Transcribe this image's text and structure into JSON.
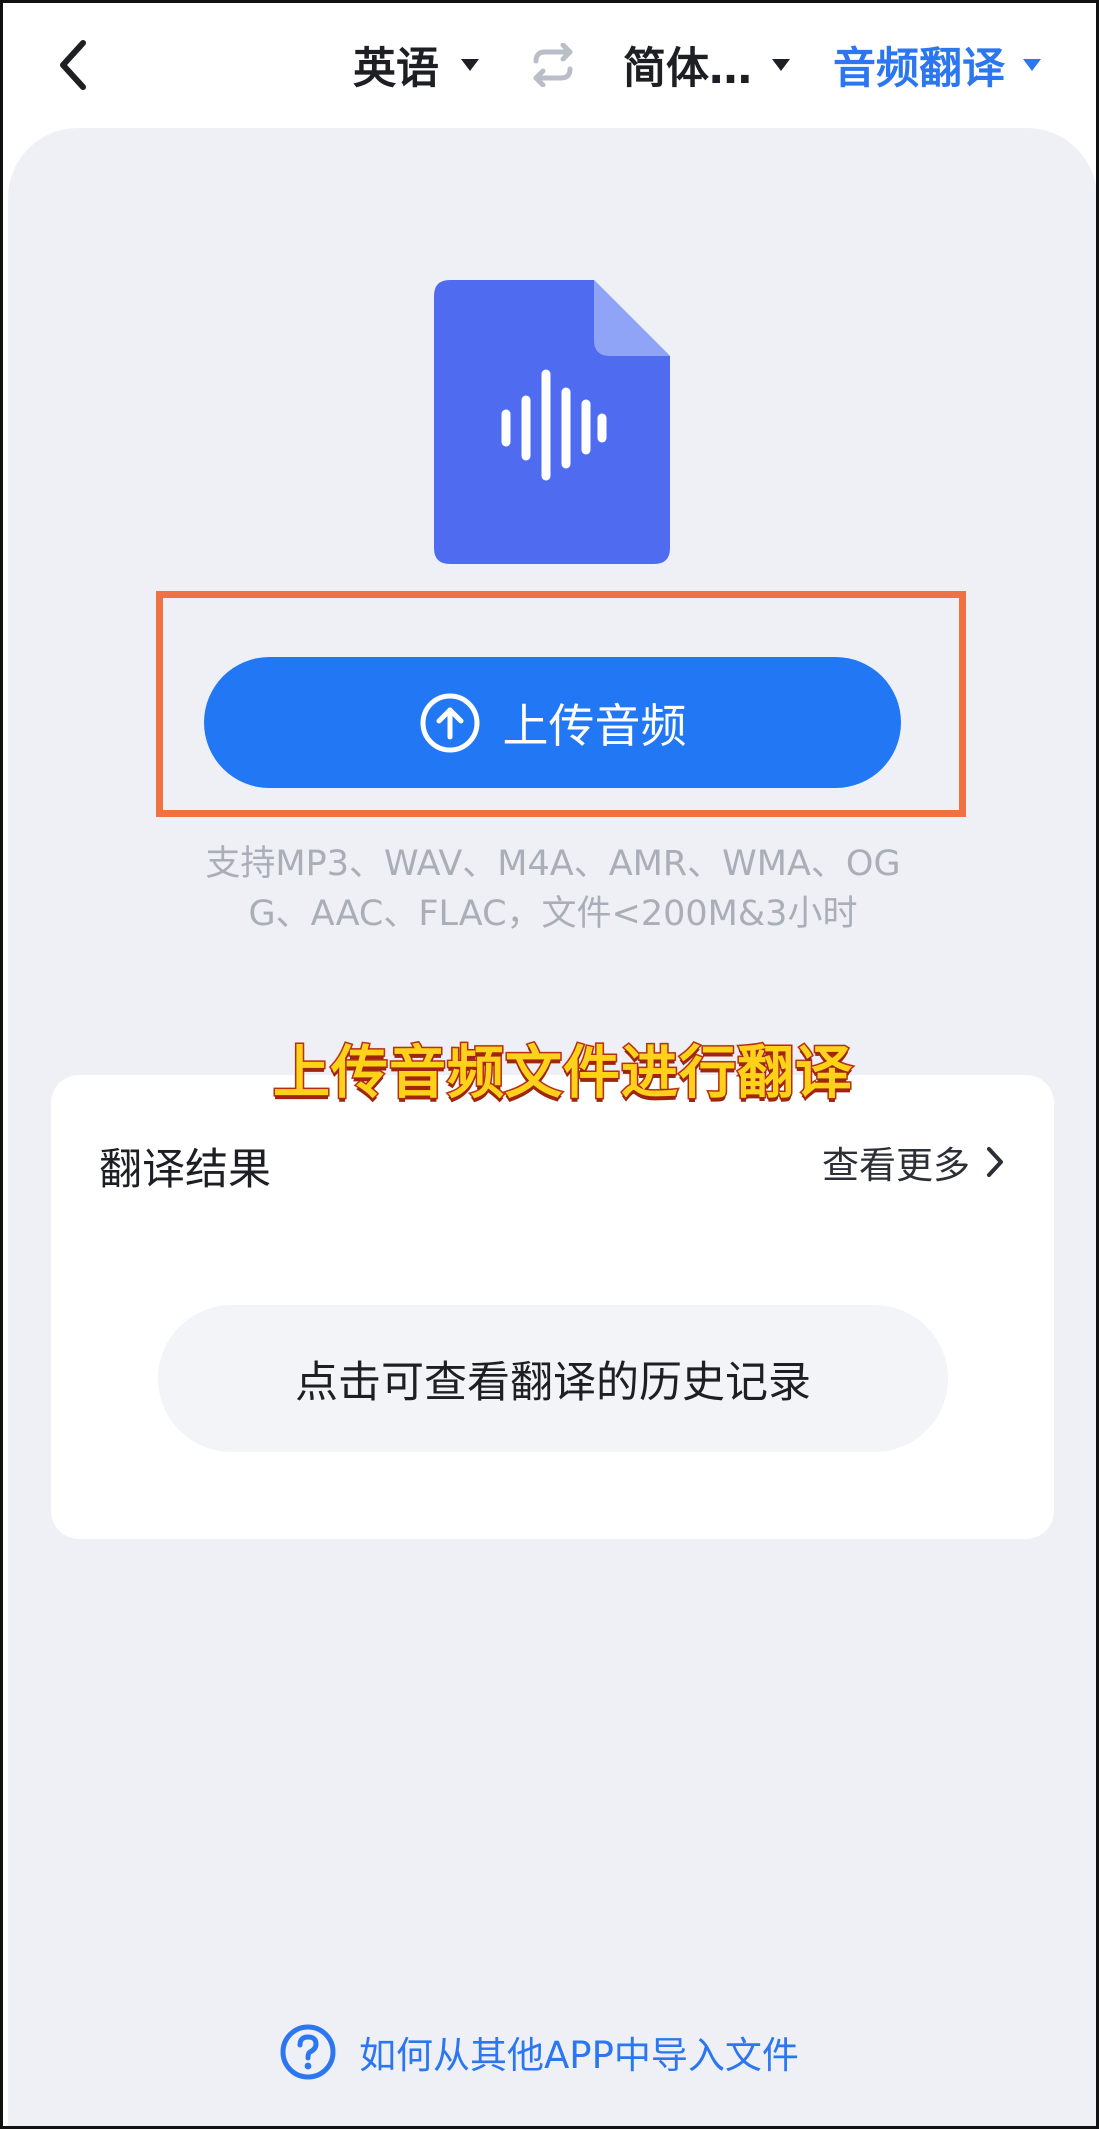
{
  "header": {
    "source_language": "英语",
    "target_language": "简体…",
    "mode": "音频翻译"
  },
  "upload": {
    "button_label": "上传音频",
    "support_text": "支持MP3、WAV、M4A、AMR、WMA、OGG、AAC、FLAC，文件<200M&3小时"
  },
  "overlay": {
    "caption": "上传音频文件进行翻译"
  },
  "results": {
    "title": "翻译结果",
    "more_label": "查看更多",
    "history_button": "点击可查看翻译的历史记录"
  },
  "footer": {
    "help_link": "如何从其他APP中导入文件"
  },
  "colors": {
    "accent": "#2177f4",
    "highlight_border": "#f07242",
    "panel_background": "#eef0f5"
  },
  "icons": {
    "back": "chevron-left-icon",
    "swap": "swap-icon",
    "file": "audio-file-icon",
    "upload": "upload-circle-icon",
    "more": "chevron-right-icon",
    "help": "question-circle-icon"
  }
}
